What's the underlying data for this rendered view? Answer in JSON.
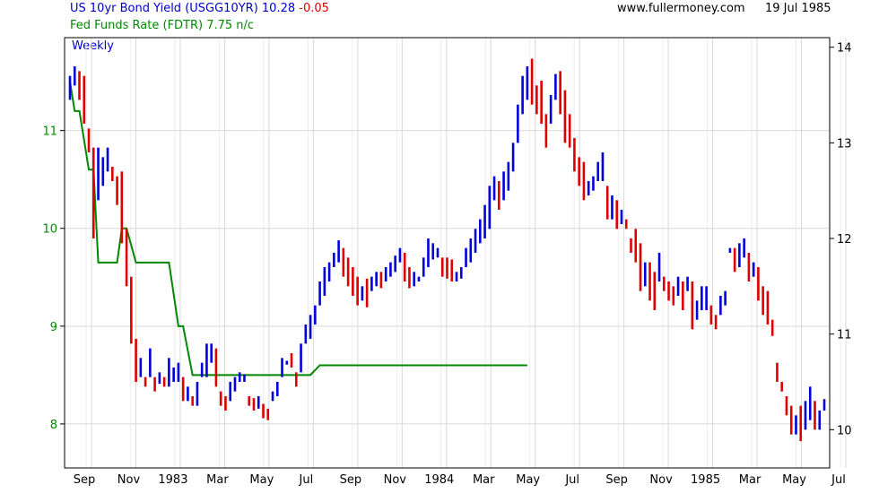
{
  "header": {
    "series1_name": "US 10yr Bond Yield (USGG10YR)",
    "series1_value": "10.28",
    "series1_change": "-0.05",
    "series2_line": "Fed Funds Rate (FDTR) 7.75 n/c",
    "site": "www.fullermoney.com",
    "date": "19 Jul 1985",
    "period": "Weekly"
  },
  "colors": {
    "up": "#0000dd",
    "down": "#dd0000",
    "fed": "#008800",
    "left_axis": "#008800",
    "right_axis": "#000000",
    "grid": "#d8d8d8",
    "blue_text": "#0000cc",
    "red_text": "#dd0000"
  },
  "chart_data": {
    "type": "line",
    "title": "US 10yr Bond Yield (USGG10YR) 10.28 -0.05",
    "subtitle": "Fed Funds Rate (FDTR) 7.75 n/c",
    "x_axis": {
      "tick_labels": [
        "Sep",
        "Nov",
        "1983",
        "Mar",
        "May",
        "Jul",
        "Sep",
        "Nov",
        "1984",
        "Mar",
        "May",
        "Jul",
        "Sep",
        "Nov",
        "1985",
        "Mar",
        "May",
        "Jul"
      ],
      "range": [
        "1982-08-06",
        "1985-07-19"
      ]
    },
    "left_axis": {
      "series": "Fed Funds Rate (FDTR)",
      "ticks": [
        8,
        9,
        10,
        11
      ],
      "range": [
        7.55,
        11.95
      ]
    },
    "right_axis": {
      "series": "US 10yr Bond Yield (USGG10YR)",
      "ticks": [
        10,
        11,
        12,
        13,
        14
      ],
      "range": [
        9.6,
        14.1
      ]
    },
    "grid": true,
    "series": [
      {
        "name": "US 10yr Bond Yield (USGG10YR)",
        "style": "weekly high-low bars",
        "axis": "right",
        "weeks": [
          [
            13.7,
            13.45
          ],
          [
            13.8,
            13.6
          ],
          [
            13.75,
            13.45
          ],
          [
            13.7,
            13.2
          ],
          [
            13.15,
            12.9
          ],
          [
            12.95,
            12.0
          ],
          [
            12.95,
            12.4
          ],
          [
            12.85,
            12.55
          ],
          [
            12.95,
            12.7
          ],
          [
            12.75,
            12.6
          ],
          [
            12.65,
            12.35
          ],
          [
            12.7,
            11.95
          ],
          [
            12.1,
            11.5
          ],
          [
            11.6,
            10.9
          ],
          [
            10.95,
            10.5
          ],
          [
            10.75,
            10.55
          ],
          [
            10.55,
            10.45
          ],
          [
            10.85,
            10.55
          ],
          [
            10.55,
            10.4
          ],
          [
            10.6,
            10.48
          ],
          [
            10.55,
            10.45
          ],
          [
            10.75,
            10.45
          ],
          [
            10.65,
            10.5
          ],
          [
            10.7,
            10.5
          ],
          [
            10.55,
            10.3
          ],
          [
            10.45,
            10.3
          ],
          [
            10.35,
            10.25
          ],
          [
            10.5,
            10.25
          ],
          [
            10.7,
            10.55
          ],
          [
            10.9,
            10.55
          ],
          [
            10.9,
            10.7
          ],
          [
            10.85,
            10.45
          ],
          [
            10.4,
            10.25
          ],
          [
            10.35,
            10.2
          ],
          [
            10.5,
            10.3
          ],
          [
            10.55,
            10.4
          ],
          [
            10.6,
            10.5
          ],
          [
            10.58,
            10.5
          ],
          [
            10.35,
            10.25
          ],
          [
            10.33,
            10.2
          ],
          [
            10.35,
            10.22
          ],
          [
            10.27,
            10.12
          ],
          [
            10.22,
            10.1
          ],
          [
            10.4,
            10.3
          ],
          [
            10.5,
            10.35
          ],
          [
            10.75,
            10.55
          ],
          [
            10.72,
            10.68
          ],
          [
            10.8,
            10.65
          ],
          [
            10.6,
            10.45
          ],
          [
            10.9,
            10.6
          ],
          [
            11.1,
            10.9
          ],
          [
            11.2,
            10.95
          ],
          [
            11.3,
            11.1
          ],
          [
            11.55,
            11.3
          ],
          [
            11.7,
            11.4
          ],
          [
            11.75,
            11.55
          ],
          [
            11.85,
            11.7
          ],
          [
            11.98,
            11.75
          ],
          [
            11.9,
            11.6
          ],
          [
            11.8,
            11.5
          ],
          [
            11.7,
            11.4
          ],
          [
            11.6,
            11.3
          ],
          [
            11.5,
            11.35
          ],
          [
            11.58,
            11.28
          ],
          [
            11.6,
            11.45
          ],
          [
            11.65,
            11.5
          ],
          [
            11.65,
            11.48
          ],
          [
            11.7,
            11.55
          ],
          [
            11.75,
            11.6
          ],
          [
            11.82,
            11.65
          ],
          [
            11.9,
            11.75
          ],
          [
            11.85,
            11.55
          ],
          [
            11.7,
            11.48
          ],
          [
            11.65,
            11.5
          ],
          [
            11.6,
            11.55
          ],
          [
            11.8,
            11.6
          ],
          [
            12.0,
            11.7
          ],
          [
            11.95,
            11.78
          ],
          [
            11.9,
            11.8
          ],
          [
            11.8,
            11.6
          ],
          [
            11.8,
            11.58
          ],
          [
            11.78,
            11.55
          ],
          [
            11.65,
            11.55
          ],
          [
            11.7,
            11.58
          ],
          [
            11.9,
            11.7
          ],
          [
            12.0,
            11.75
          ],
          [
            12.1,
            11.85
          ],
          [
            12.2,
            11.95
          ],
          [
            12.35,
            12.0
          ],
          [
            12.55,
            12.1
          ],
          [
            12.65,
            12.4
          ],
          [
            12.6,
            12.3
          ],
          [
            12.7,
            12.4
          ],
          [
            12.8,
            12.5
          ],
          [
            13.0,
            12.7
          ],
          [
            13.4,
            13.0
          ],
          [
            13.7,
            13.3
          ],
          [
            13.8,
            13.45
          ],
          [
            13.88,
            13.4
          ],
          [
            13.6,
            13.3
          ],
          [
            13.65,
            13.2
          ],
          [
            13.3,
            12.95
          ],
          [
            13.5,
            13.2
          ],
          [
            13.72,
            13.45
          ],
          [
            13.75,
            13.3
          ],
          [
            13.55,
            13.0
          ],
          [
            13.3,
            12.95
          ],
          [
            13.05,
            12.7
          ],
          [
            12.85,
            12.55
          ],
          [
            12.8,
            12.4
          ],
          [
            12.6,
            12.45
          ],
          [
            12.65,
            12.5
          ],
          [
            12.8,
            12.6
          ],
          [
            12.9,
            12.6
          ],
          [
            12.55,
            12.2
          ],
          [
            12.45,
            12.2
          ],
          [
            12.4,
            12.1
          ],
          [
            12.3,
            12.15
          ],
          [
            12.2,
            12.1
          ],
          [
            12.0,
            11.85
          ],
          [
            12.1,
            11.75
          ],
          [
            11.95,
            11.45
          ],
          [
            11.75,
            11.5
          ],
          [
            11.75,
            11.35
          ],
          [
            11.65,
            11.25
          ],
          [
            11.85,
            11.55
          ],
          [
            11.6,
            11.45
          ],
          [
            11.55,
            11.35
          ],
          [
            11.5,
            11.3
          ],
          [
            11.6,
            11.4
          ],
          [
            11.55,
            11.25
          ],
          [
            11.6,
            11.45
          ],
          [
            11.55,
            11.05
          ],
          [
            11.35,
            11.15
          ],
          [
            11.5,
            11.25
          ],
          [
            11.5,
            11.25
          ],
          [
            11.3,
            11.1
          ],
          [
            11.2,
            11.05
          ],
          [
            11.4,
            11.2
          ],
          [
            11.45,
            11.3
          ],
          [
            11.9,
            11.85
          ],
          [
            11.9,
            11.65
          ],
          [
            11.95,
            11.7
          ],
          [
            12.0,
            11.8
          ],
          [
            11.85,
            11.55
          ],
          [
            11.75,
            11.6
          ],
          [
            11.7,
            11.35
          ],
          [
            11.5,
            11.2
          ],
          [
            11.45,
            11.1
          ],
          [
            11.15,
            10.98
          ],
          [
            10.7,
            10.5
          ],
          [
            10.5,
            10.4
          ],
          [
            10.35,
            10.15
          ],
          [
            10.25,
            9.95
          ],
          [
            10.15,
            9.95
          ],
          [
            10.25,
            9.88
          ],
          [
            10.3,
            10.0
          ],
          [
            10.45,
            10.1
          ],
          [
            10.3,
            10.0
          ],
          [
            10.2,
            10.0
          ],
          [
            10.32,
            10.2
          ]
        ]
      },
      {
        "name": "Fed Funds Rate (FDTR)",
        "style": "step line",
        "axis": "left",
        "steps": [
          [
            0,
            11.5
          ],
          [
            1,
            11.2
          ],
          [
            2,
            11.2
          ],
          [
            4,
            10.6
          ],
          [
            5,
            10.6
          ],
          [
            6,
            9.65
          ],
          [
            10,
            9.65
          ],
          [
            11,
            10.0
          ],
          [
            12,
            10.0
          ],
          [
            14,
            9.65
          ],
          [
            21,
            9.65
          ],
          [
            23,
            9.0
          ],
          [
            24,
            9.0
          ],
          [
            26,
            8.5
          ],
          [
            51,
            8.5
          ],
          [
            53,
            8.6
          ],
          [
            54,
            8.6
          ],
          [
            55,
            8.6
          ],
          [
            56,
            8.6
          ],
          [
            57,
            8.6
          ],
          [
            58,
            8.6
          ],
          [
            59,
            8.6
          ],
          [
            60,
            8.6
          ],
          [
            61,
            8.6
          ],
          [
            62,
            8.6
          ],
          [
            63,
            8.6
          ],
          [
            64,
            8.6
          ],
          [
            65,
            8.6
          ],
          [
            66,
            8.6
          ],
          [
            67,
            8.6
          ],
          [
            68,
            8.6
          ],
          [
            69,
            8.6
          ],
          [
            70,
            8.6
          ],
          [
            71,
            8.6
          ],
          [
            72,
            8.6
          ],
          [
            73,
            8.6
          ],
          [
            74,
            8.6
          ],
          [
            75,
            8.6
          ],
          [
            76,
            8.6
          ],
          [
            77,
            8.6
          ],
          [
            78,
            8.6
          ],
          [
            79,
            8.6
          ],
          [
            80,
            8.6
          ],
          [
            81,
            8.6
          ],
          [
            82,
            8.6
          ],
          [
            83,
            8.6
          ],
          [
            84,
            8.6
          ],
          [
            85,
            8.6
          ],
          [
            86,
            8.6
          ],
          [
            87,
            8.6
          ],
          [
            88,
            8.6
          ],
          [
            89,
            8.6
          ],
          [
            90,
            8.6
          ],
          [
            91,
            8.6
          ],
          [
            92,
            8.6
          ],
          [
            93,
            8.6
          ],
          [
            94,
            8.6
          ],
          [
            95,
            8.6
          ],
          [
            96,
            8.6
          ],
          [
            97,
            8.6
          ]
        ]
      }
    ]
  }
}
